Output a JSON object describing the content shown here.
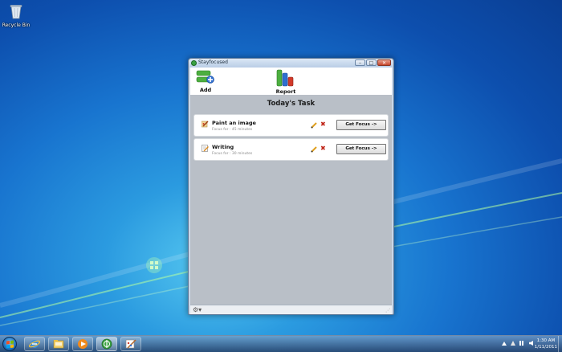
{
  "desktop": {
    "recycle_bin_label": "Recycle Bin"
  },
  "window": {
    "title": "Stayfocused",
    "buttons": {
      "minimize": "–",
      "maximize": "□",
      "close": "✕"
    },
    "toolbar": {
      "add_label": "Add",
      "report_label": "Report"
    },
    "heading": "Today's Task",
    "tasks": [
      {
        "name": "Paint an image",
        "focus_for": "Focus for : 45 minutes",
        "button": "Get Focus ->",
        "icon": "paintbrush-icon"
      },
      {
        "name": "Writing",
        "focus_for": "Focus for : 30 minutes",
        "button": "Get Focus ->",
        "icon": "notepad-icon"
      }
    ]
  },
  "taskbar": {
    "clock_time": "1:30 AM",
    "clock_date": "1/11/2011",
    "pinned": [
      "internet-explorer-icon",
      "windows-explorer-icon",
      "media-player-icon",
      "stayfocused-icon",
      "paint-icon"
    ]
  },
  "colors": {
    "desktop_blue": "#1874cf",
    "window_content_bg": "#b9bfc7",
    "delete_red": "#c0261a"
  }
}
